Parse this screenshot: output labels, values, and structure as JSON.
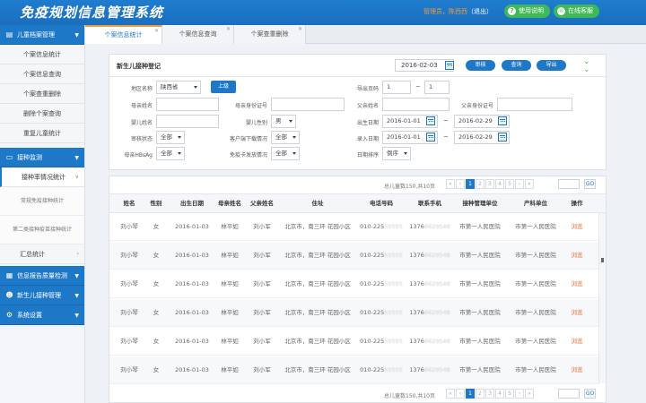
{
  "header": {
    "title": "免疫规划信息管理系统",
    "user": "管理员，陈西西",
    "logout_open": "（",
    "logout": "退出",
    "logout_close": "）",
    "help_btn": "使用说明",
    "service_btn": "在线客服",
    "accent_color": "#1e78c8",
    "green_color": "#3fb957",
    "orange_color": "#f39a3c"
  },
  "sidebar": {
    "sec1": "儿童档案管理",
    "items1": [
      "个案信息统计",
      "个案信息查询",
      "个案查重删除",
      "删除个案查询",
      "重复儿童统计"
    ],
    "sec2": "接种监测",
    "rate_item": "接种率情况统计",
    "subs": [
      "常规免疫接种统计",
      "第二类接种疫苗接种统计"
    ],
    "summary": "汇总统计",
    "sec3": "信息报告质量检测",
    "sec4": "新生儿接种管理",
    "sec5": "系统设置"
  },
  "tabs": [
    "个案信息统计",
    "个案信息查询",
    "个案查重删除"
  ],
  "panel": {
    "title": "新生儿接种登记",
    "date": "2016-02-03",
    "btn_audit": "审核",
    "btn_query": "查询",
    "btn_export": "导出",
    "f_region": "地区名称",
    "v_region": "陕西省",
    "btn_up": "上级",
    "f_export_page": "导出页码",
    "v_page_from": "1",
    "tilde": "~",
    "v_page_to": "1",
    "f_mother": "母亲姓名",
    "f_mother_id": "母亲身份证号",
    "f_father": "父亲姓名",
    "f_father_id": "父亲身份证号",
    "f_baby": "婴儿姓名",
    "f_baby_sex": "婴儿性别",
    "v_sex": "男",
    "f_birth": "出生日期",
    "v_birth_from": "2016-01-01",
    "v_birth_to": "2016-02-29",
    "f_audit": "审核状态",
    "v_all": "全部",
    "f_download": "客户端下载情况",
    "f_entry": "录入日期",
    "v_entry_from": "2016-01-01",
    "v_entry_to": "2016-02-29",
    "f_hbsag": "母亲HBsAg",
    "f_card": "免疫卡发放情况",
    "f_order": "日期排序",
    "v_order": "倒序"
  },
  "table": {
    "total": "总儿童数150,共10页",
    "pages": [
      "«",
      "‹",
      "1",
      "2",
      "3",
      "4",
      "5",
      "›",
      "»"
    ],
    "go": "GO",
    "columns": [
      "姓名",
      "性别",
      "出生日期",
      "母亲姓名",
      "父亲姓名",
      "住址",
      "电话号码",
      "联系手机",
      "接种管理单位",
      "产科单位",
      "操作"
    ],
    "rows": [
      [
        "刘小琴",
        "女",
        "2016-01-03",
        "林平如",
        "刘小军",
        "北京市，南三环 花园小区",
        "010-225",
        "55555",
        "1376",
        "6629548",
        "市第一人民医院",
        "市第一人民医院",
        "浏览"
      ],
      [
        "刘小琴",
        "女",
        "2016-01-03",
        "林平如",
        "刘小军",
        "北京市，南三环 花园小区",
        "010-225",
        "55555",
        "1376",
        "6629548",
        "市第一人民医院",
        "市第一人民医院",
        "浏览"
      ],
      [
        "刘小琴",
        "女",
        "2016-01-03",
        "林平如",
        "刘小军",
        "北京市，南三环 花园小区",
        "010-225",
        "55555",
        "1376",
        "6629548",
        "市第一人民医院",
        "市第一人民医院",
        "浏览"
      ],
      [
        "刘小琴",
        "女",
        "2016-01-03",
        "林平如",
        "刘小军",
        "北京市，南三环 花园小区",
        "010-225",
        "55555",
        "1376",
        "6629548",
        "市第一人民医院",
        "市第一人民医院",
        "浏览"
      ],
      [
        "刘小琴",
        "女",
        "2016-01-03",
        "林平如",
        "刘小军",
        "北京市，南三环 花园小区",
        "010-225",
        "55555",
        "1376",
        "6629548",
        "市第一人民医院",
        "市第一人民医院",
        "浏览"
      ],
      [
        "刘小琴",
        "女",
        "2016-01-03",
        "林平如",
        "刘小军",
        "北京市，南三环 花园小区",
        "010-225",
        "55555",
        "1376",
        "6629548",
        "市第一人民医院",
        "市第一人民医院",
        "浏览"
      ]
    ]
  }
}
